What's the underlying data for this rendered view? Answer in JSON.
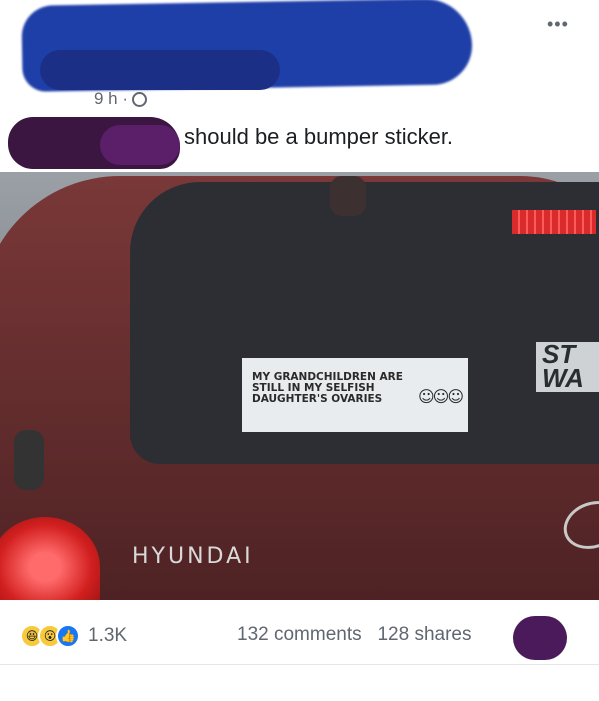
{
  "post": {
    "time": "9 h ·",
    "caption": "should be a bumper sticker.",
    "more_icon": "more-icon"
  },
  "photo": {
    "sticker_lines": [
      "MY GRANDCHILDREN ARE",
      "STILL IN MY SELFISH",
      "DAUGHTER'S OVARIES"
    ],
    "car_badge": "HYUNDAI",
    "rear_sticker": "ST\nWA"
  },
  "footer": {
    "reaction_count": "1.3K",
    "comments": "132 comments",
    "shares": "128 shares"
  },
  "icons": [
    "globe-icon",
    "more-icon",
    "haha-reaction-icon",
    "wow-reaction-icon",
    "like-reaction-icon"
  ]
}
